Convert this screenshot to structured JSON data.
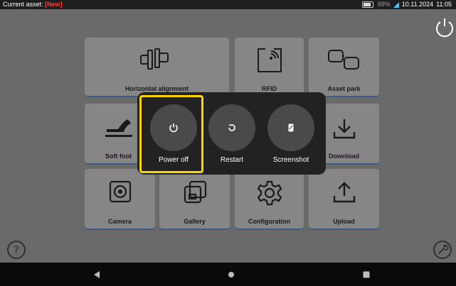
{
  "status_bar": {
    "asset_label": "Current asset:",
    "asset_value": "[New]",
    "battery": "99%",
    "date": "10.11.2024",
    "time": "11:05"
  },
  "tiles": {
    "horizontal_alignment": "Horizontal alignment",
    "rfid": "RFID",
    "asset_park": "Asset park",
    "soft_foot": "Soft foot",
    "download": "Download",
    "camera": "Camera",
    "gallery": "Gallery",
    "configuration": "Configuration",
    "upload": "Upload"
  },
  "power_menu": {
    "power_off": "Power off",
    "restart": "Restart",
    "screenshot": "Screenshot"
  },
  "colors": {
    "highlight": "#ffd400",
    "asset_new": "#ff3b30",
    "tile_underline": "#3f5d80"
  }
}
